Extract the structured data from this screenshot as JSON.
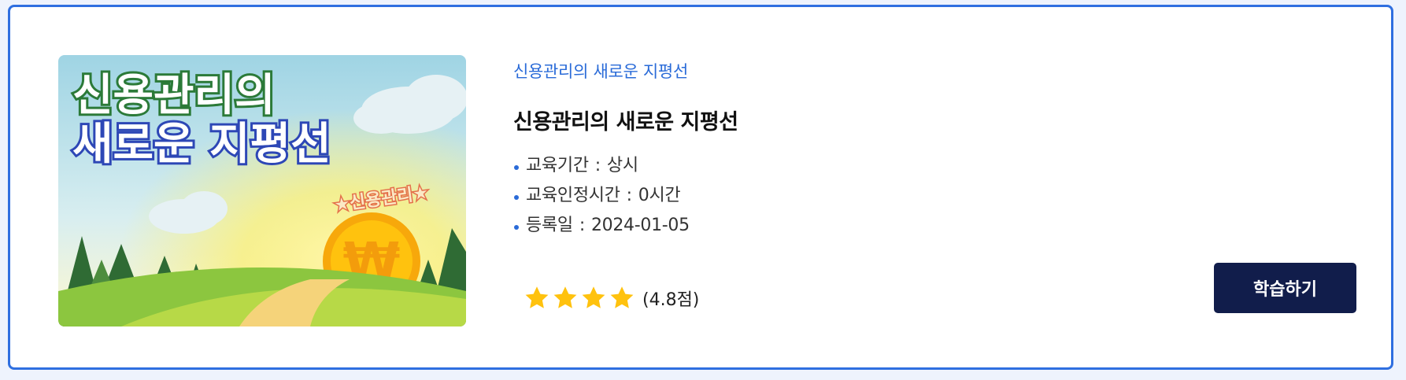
{
  "course": {
    "category": "신용관리의 새로운 지평선",
    "title": "신용관리의 새로운 지평선",
    "thumbnail": {
      "headline_line1": "신용관리의",
      "headline_line2": "새로운 지평선",
      "badge": "★신용관리★",
      "coin_symbol": "₩"
    },
    "info": [
      {
        "label": "교육기간",
        "value": "상시"
      },
      {
        "label": "교육인정시간",
        "value": "0시간"
      },
      {
        "label": "등록일",
        "value": "2024-01-05"
      }
    ],
    "rating": {
      "stars_filled": 4,
      "score": 4.8,
      "label": "(4.8점)"
    },
    "button_label": "학습하기"
  },
  "colors": {
    "accent": "#2a6bd8",
    "card_border": "#2f6fe0",
    "button": "#111d4b",
    "star": "#ffc20e"
  }
}
